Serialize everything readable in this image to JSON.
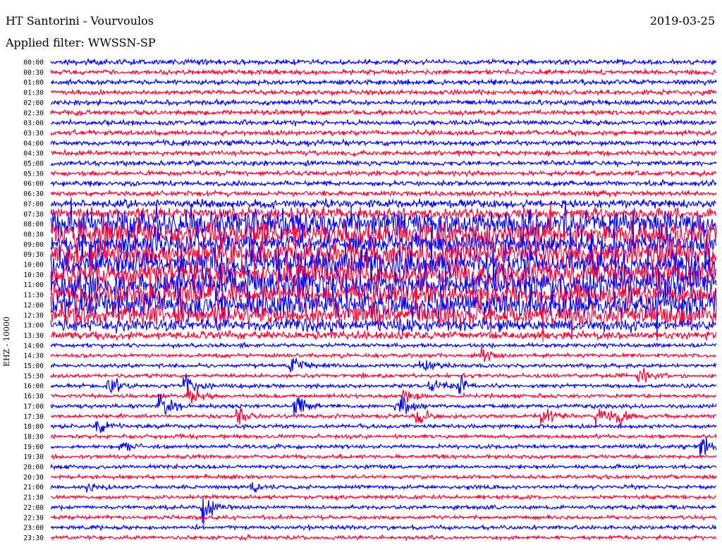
{
  "header": {
    "station": "HT Santorini - Vourvoulos",
    "date": "2019-03-25",
    "filter": "Applied filter: WWSSN-SP"
  },
  "chart_data": {
    "type": "line",
    "title": "HT Santorini - Vourvoulos",
    "ylabel": "EHZ - 10000",
    "row_labels": [
      "00:00",
      "00:30",
      "01:00",
      "01:30",
      "02:00",
      "02:30",
      "03:00",
      "03:30",
      "04:00",
      "04:30",
      "05:00",
      "05:30",
      "06:00",
      "06:30",
      "07:00",
      "07:30",
      "08:00",
      "08:30",
      "09:00",
      "09:30",
      "10:00",
      "10:30",
      "11:00",
      "11:30",
      "12:00",
      "12:30",
      "13:00",
      "13:30",
      "14:00",
      "14:30",
      "15:00",
      "15:30",
      "16:00",
      "16:30",
      "17:00",
      "17:30",
      "18:00",
      "18:30",
      "19:00",
      "19:30",
      "20:00",
      "20:30",
      "21:00",
      "21:30",
      "22:00",
      "22:30",
      "23:00",
      "23:30"
    ],
    "colors": {
      "even_rows": "#0000ff",
      "odd_rows": "#ff0033",
      "text": "#000000"
    }
  }
}
